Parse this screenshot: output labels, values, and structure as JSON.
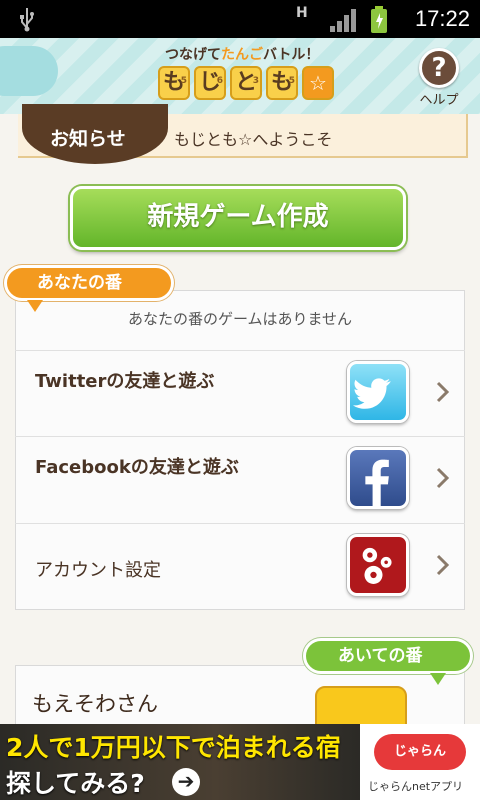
{
  "status_bar": {
    "network": "H",
    "time": "17:22"
  },
  "header": {
    "logo_subtitle_a": "つなげて",
    "logo_subtitle_b": "たんご",
    "logo_subtitle_c": "バトル！",
    "logo_tiles": [
      {
        "char": "も",
        "score": "5"
      },
      {
        "char": "じ",
        "score": "6"
      },
      {
        "char": "と",
        "score": "3"
      },
      {
        "char": "も",
        "score": "5"
      },
      {
        "char": "☆",
        "score": ""
      }
    ],
    "help_label": "ヘルプ",
    "help_icon": "?"
  },
  "news": {
    "tag": "お知らせ",
    "text": "もじとも☆へようこそ"
  },
  "new_game_label": "新規ゲーム作成",
  "your_turn": {
    "tab_label": "あなたの番",
    "empty_message": "あなたの番のゲームはありません",
    "rows": [
      {
        "label": "Twitterの友達と遊ぶ",
        "icon": "twitter-icon"
      },
      {
        "label": "Facebookの友達と遊ぶ",
        "icon": "facebook-icon"
      },
      {
        "label": "アカウント設定",
        "icon": "account-settings-icon"
      }
    ]
  },
  "opponent_turn": {
    "tab_label": "あいての番",
    "games": [
      {
        "name": "もえそわさん"
      }
    ]
  },
  "ad": {
    "line1": "2人で1万円以下で泊まれる宿",
    "line2": "探してみる?",
    "brand_badge": "じゃらん",
    "brand_text": "じゃらんnetアプリ"
  }
}
